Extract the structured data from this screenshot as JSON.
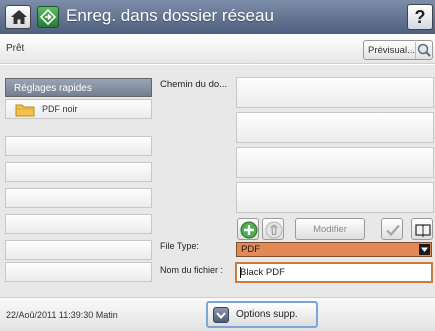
{
  "header": {
    "title": "Enreg. dans dossier réseau",
    "help_glyph": "?",
    "icons": {
      "home": "home-icon",
      "app": "network-folder-icon",
      "help": "help-icon"
    },
    "color": "#5b6c8c"
  },
  "status": {
    "text": "Prêt",
    "preview_label": "Prévisual...",
    "preview_icon": "magnifier-icon"
  },
  "quick_sets": {
    "header": "Réglages rapides",
    "items": [
      {
        "label": "PDF noir",
        "icon": "folder-icon"
      },
      {
        "label": ""
      },
      {
        "label": ""
      },
      {
        "label": ""
      },
      {
        "label": ""
      },
      {
        "label": ""
      },
      {
        "label": ""
      },
      {
        "label": ""
      }
    ]
  },
  "path": {
    "label": "Chemin du do...",
    "rows": [
      "",
      "",
      "",
      "",
      ""
    ]
  },
  "toolbar": {
    "add_icon": "add-icon",
    "delete_icon": "trash-icon",
    "modify_label": "Modifier",
    "check_icon": "check-icon",
    "book_icon": "book-icon"
  },
  "file_type": {
    "label": "File Type:",
    "value": "PDF",
    "color": "#e38956"
  },
  "file_name": {
    "label": "Nom du fichier :",
    "value": "Black PDF",
    "border_color": "#d07a3a"
  },
  "footer": {
    "datetime": "22/Aoû/2011 11:39:30 Matin",
    "options_label": "Options supp.",
    "options_icon": "chevron-down-icon"
  }
}
